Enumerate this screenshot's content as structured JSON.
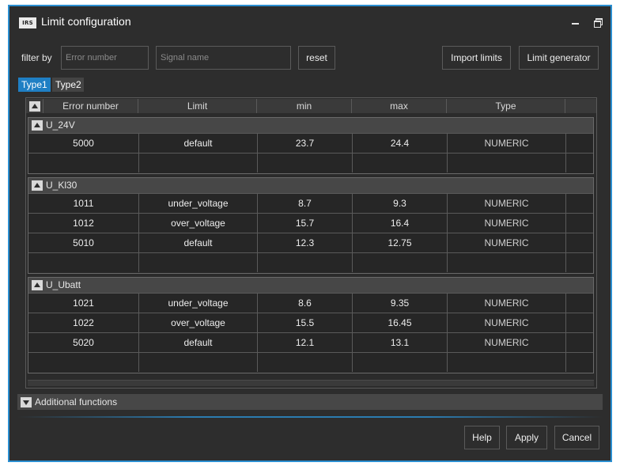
{
  "window": {
    "logo_text": "IRS",
    "title": "Limit configuration"
  },
  "filter": {
    "label": "filter by",
    "error_number_placeholder": "Error number",
    "signal_name_placeholder": "Signal name",
    "reset_label": "reset"
  },
  "toolbar": {
    "import_label": "Import limits",
    "generator_label": "Limit generator"
  },
  "tabs": [
    {
      "label": "Type1",
      "selected": true
    },
    {
      "label": "Type2",
      "selected": false
    }
  ],
  "columns": [
    "Error number",
    "Limit",
    "min",
    "max",
    "Type"
  ],
  "groups": [
    {
      "name": "U_24V",
      "rows": [
        {
          "error_number": "5000",
          "limit": "default",
          "min": "23.7",
          "max": "24.4",
          "type": "NUMERIC"
        }
      ]
    },
    {
      "name": "U_Kl30",
      "rows": [
        {
          "error_number": "1011",
          "limit": "under_voltage",
          "min": "8.7",
          "max": "9.3",
          "type": "NUMERIC"
        },
        {
          "error_number": "1012",
          "limit": "over_voltage",
          "min": "15.7",
          "max": "16.4",
          "type": "NUMERIC"
        },
        {
          "error_number": "5010",
          "limit": "default",
          "min": "12.3",
          "max": "12.75",
          "type": "NUMERIC"
        }
      ]
    },
    {
      "name": "U_Ubatt",
      "rows": [
        {
          "error_number": "1021",
          "limit": "under_voltage",
          "min": "8.6",
          "max": "9.35",
          "type": "NUMERIC"
        },
        {
          "error_number": "1022",
          "limit": "over_voltage",
          "min": "15.5",
          "max": "16.45",
          "type": "NUMERIC"
        },
        {
          "error_number": "5020",
          "limit": "default",
          "min": "12.1",
          "max": "13.1",
          "type": "NUMERIC"
        }
      ]
    }
  ],
  "additional": {
    "label": "Additional functions"
  },
  "footer": {
    "help_label": "Help",
    "apply_label": "Apply",
    "cancel_label": "Cancel"
  },
  "colors": {
    "accent": "#2b8fd1",
    "selected_tab": "#1f7fc4",
    "background": "#2d2d2d"
  }
}
